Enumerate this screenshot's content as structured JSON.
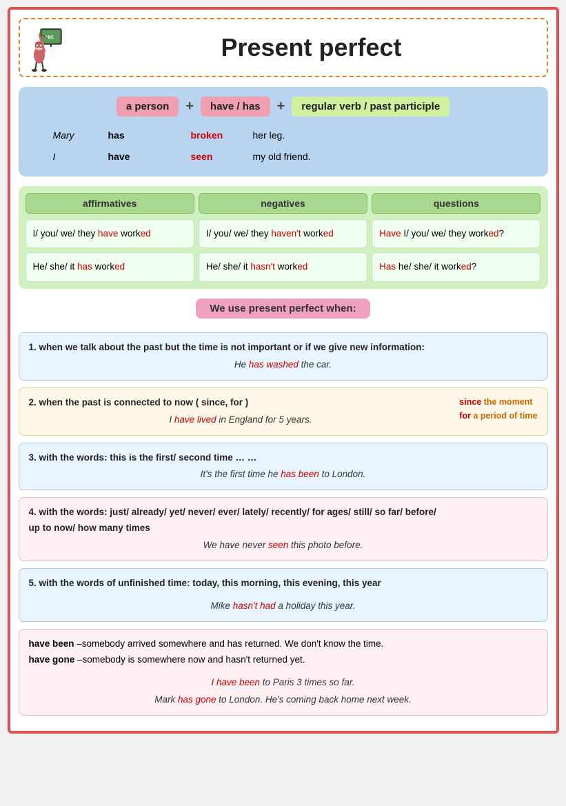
{
  "header": {
    "title": "Present perfect"
  },
  "formula": {
    "pill1": "a person",
    "pill2": "have / has",
    "pill3": "regular verb / past participle",
    "examples": [
      {
        "name": "Mary",
        "verb": "has",
        "pp": "broken",
        "rest": "her leg."
      },
      {
        "name": "I",
        "verb": "have",
        "pp": "seen",
        "rest": "my old friend."
      }
    ]
  },
  "grammar": {
    "headers": [
      "affirmatives",
      "negatives",
      "questions"
    ],
    "rows": [
      {
        "affirmative": "I/ you/ we/ they have worked",
        "negative": "I/ you/ we/ they haven't worked",
        "question": "Have I/ you/ we/ they worked?"
      },
      {
        "affirmative": "He/ she/ it has worked",
        "negative": "He/ she/ it hasn't worked",
        "question": "Has he/ she/ it worked?"
      }
    ]
  },
  "use_when_title": "We use present perfect when:",
  "rules": [
    {
      "id": "rule1",
      "title": "1. when we talk about the past but the time is not important or if we give new information:",
      "example": "He has washed the car."
    },
    {
      "id": "rule2",
      "title": "2. when the past is connected to now  ( since, for )",
      "example": "I have lived in England for 5 years.",
      "side_note": "since the moment\nfor a period of time"
    },
    {
      "id": "rule3",
      "title": "3. with the words: this is the first/ second time … …",
      "example": "It's the first time he has been to London."
    },
    {
      "id": "rule4",
      "title": "4. with the words: just/ already/ yet/ never/ ever/ lately/ recently/ for ages/ still/ so far/ before/ up to now/ how many times",
      "example": "We have never seen this photo before."
    },
    {
      "id": "rule5",
      "title": "5. with the words of unfinished time: today, this morning, this evening, this year",
      "example": "Mike hasn't had a holiday this year."
    },
    {
      "id": "rule6",
      "title1": "6. have been –somebody arrived somewhere and has returned. We don't know the time.",
      "title2": "have gone –somebody is somewhere now and hasn't returned yet.",
      "example1": "I have been to Paris 3 times so far.",
      "example2": "Mark has gone to London. He's coming back home next week."
    }
  ]
}
